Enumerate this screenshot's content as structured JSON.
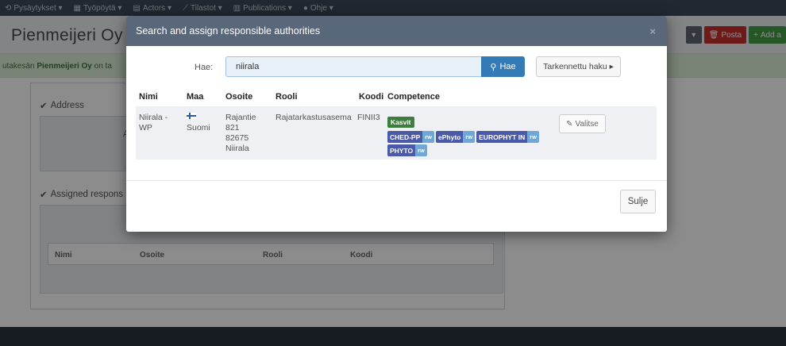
{
  "topnav": {
    "items": [
      "Pysäytykset ▾",
      "Työpöytä ▾",
      "Actors ▾",
      "Tilastot ▾",
      "Publications ▾",
      "Ohje ▾"
    ],
    "icons": [
      "history-icon",
      "dashboard-icon",
      "users-icon",
      "chart-icon",
      "book-icon",
      "help-icon"
    ]
  },
  "header": {
    "company": "Pienmeijeri Oy",
    "posta_label": "Posta",
    "add_label": "Add a"
  },
  "infobar": {
    "prefix": "utakesän",
    "company": "Pienmeijeri Oy",
    "suffix": "on ta"
  },
  "background": {
    "address_heading": "Address",
    "address_box_letter": "A",
    "assigned_heading": "Assigned respons",
    "table_headers": [
      "Nimi",
      "Osoite",
      "Rooli",
      "Koodi"
    ]
  },
  "modal": {
    "title": "Search and assign responsible authorities",
    "close": "×",
    "search_label": "Hae:",
    "search_value": "niirala",
    "search_button": "Hae",
    "advanced_button": "Tarkennettu haku ▸",
    "columns": [
      "Nimi",
      "Maa",
      "Osoite",
      "Rooli",
      "Koodi",
      "Competence"
    ],
    "result": {
      "name": "Niirala - WP",
      "country": "Suomi",
      "address_lines": [
        "Rajantie",
        "821",
        "82675",
        "Niirala"
      ],
      "role": "Rajatarkastusasema",
      "code": "FINII3",
      "competence_group": "Kasvit",
      "badges": [
        {
          "label": "CHED-PP",
          "access": "rw"
        },
        {
          "label": "ePhyto",
          "access": "rw"
        },
        {
          "label": "EUROPHYT IN",
          "access": "rw"
        },
        {
          "label": "PHYTO",
          "access": "rw"
        }
      ],
      "select_button": "Valitse"
    },
    "close_button": "Sulje"
  },
  "colors": {
    "modal_header": "#58677a",
    "primary": "#337ab7",
    "success_bg": "#dff0d8",
    "badge_green": "#3f7d3f",
    "badge_blue": "#4a5aa8",
    "badge_rw": "#6fa7d6"
  }
}
